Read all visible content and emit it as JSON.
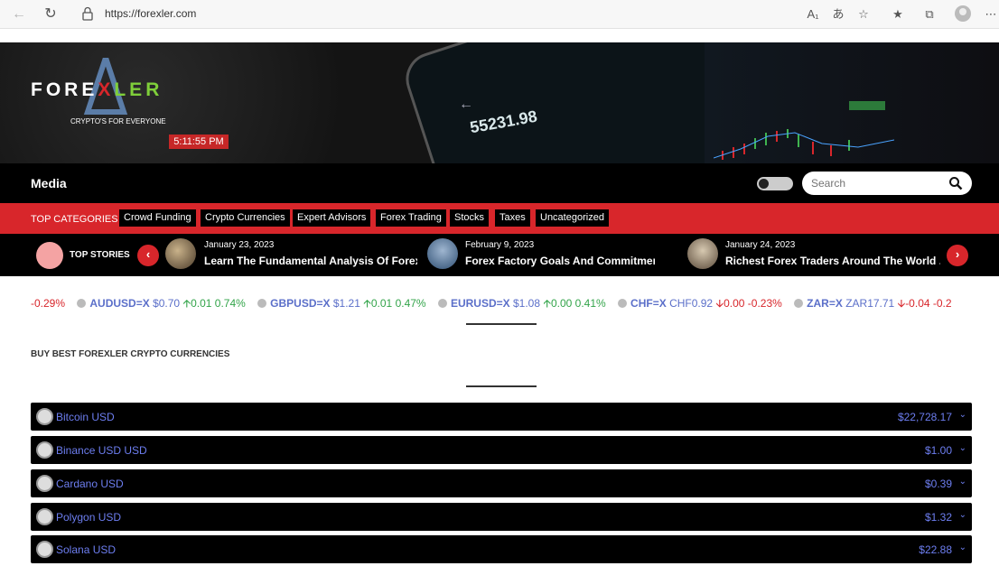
{
  "browser": {
    "url": "https://forexler.com",
    "toolbar_icons": [
      "read-aloud-icon",
      "translate-icon",
      "favorite-add-icon",
      "favorites-icon",
      "collections-icon",
      "profile-icon",
      "more-icon"
    ]
  },
  "banner": {
    "logo_text_part1": "FORE",
    "logo_text_part2": "X",
    "logo_text_part3": "LER",
    "tagline": "CRYPTO'S FOR EVERYONE",
    "clock": "5:11:55 PM",
    "phone_value": "55231.98"
  },
  "mediabar": {
    "title": "Media",
    "search_placeholder": "Search"
  },
  "categories": {
    "label": "TOP CATEGORIES",
    "items": [
      "Crowd Funding",
      "Crypto Currencies",
      "Expert Advisors",
      "Forex Trading",
      "Stocks",
      "Taxes",
      "Uncategorized"
    ]
  },
  "top_stories": {
    "label": "TOP STORIES",
    "items": [
      {
        "date": "January 23, 2023",
        "title": "Learn The Fundamental Analysis Of Forex..."
      },
      {
        "date": "February 9, 2023",
        "title": "Forex Factory Goals And Commitments..."
      },
      {
        "date": "January 24, 2023",
        "title": "Richest Forex Traders Around The World ..."
      }
    ]
  },
  "ticker": {
    "lead": "-0.29%",
    "items": [
      {
        "symbol": "AUDUSD=X",
        "price": "$0.70",
        "dir": "up",
        "change": "0.01",
        "pct": "0.74%"
      },
      {
        "symbol": "GBPUSD=X",
        "price": "$1.21",
        "dir": "up",
        "change": "0.01",
        "pct": "0.47%"
      },
      {
        "symbol": "EURUSD=X",
        "price": "$1.08",
        "dir": "up",
        "change": "0.00",
        "pct": "0.41%"
      },
      {
        "symbol": "CHF=X",
        "price": "CHF0.92",
        "dir": "down",
        "change": "0.00",
        "pct": "-0.23%"
      },
      {
        "symbol": "ZAR=X",
        "price": "ZAR17.71",
        "dir": "down",
        "change": "-0.04",
        "pct": "-0.2"
      }
    ]
  },
  "section": {
    "title": "BUY BEST FOREXLER CRYPTO CURRENCIES"
  },
  "cryptos": [
    {
      "name": "Bitcoin USD",
      "price": "$22,728.17"
    },
    {
      "name": "Binance USD USD",
      "price": "$1.00"
    },
    {
      "name": "Cardano USD",
      "price": "$0.39"
    },
    {
      "name": "Polygon USD",
      "price": "$1.32"
    },
    {
      "name": "Solana USD",
      "price": "$22.88"
    }
  ],
  "colors": {
    "brand_red": "#d8262b",
    "link_blue": "#6d7ef0",
    "up_green": "#33a44a"
  }
}
